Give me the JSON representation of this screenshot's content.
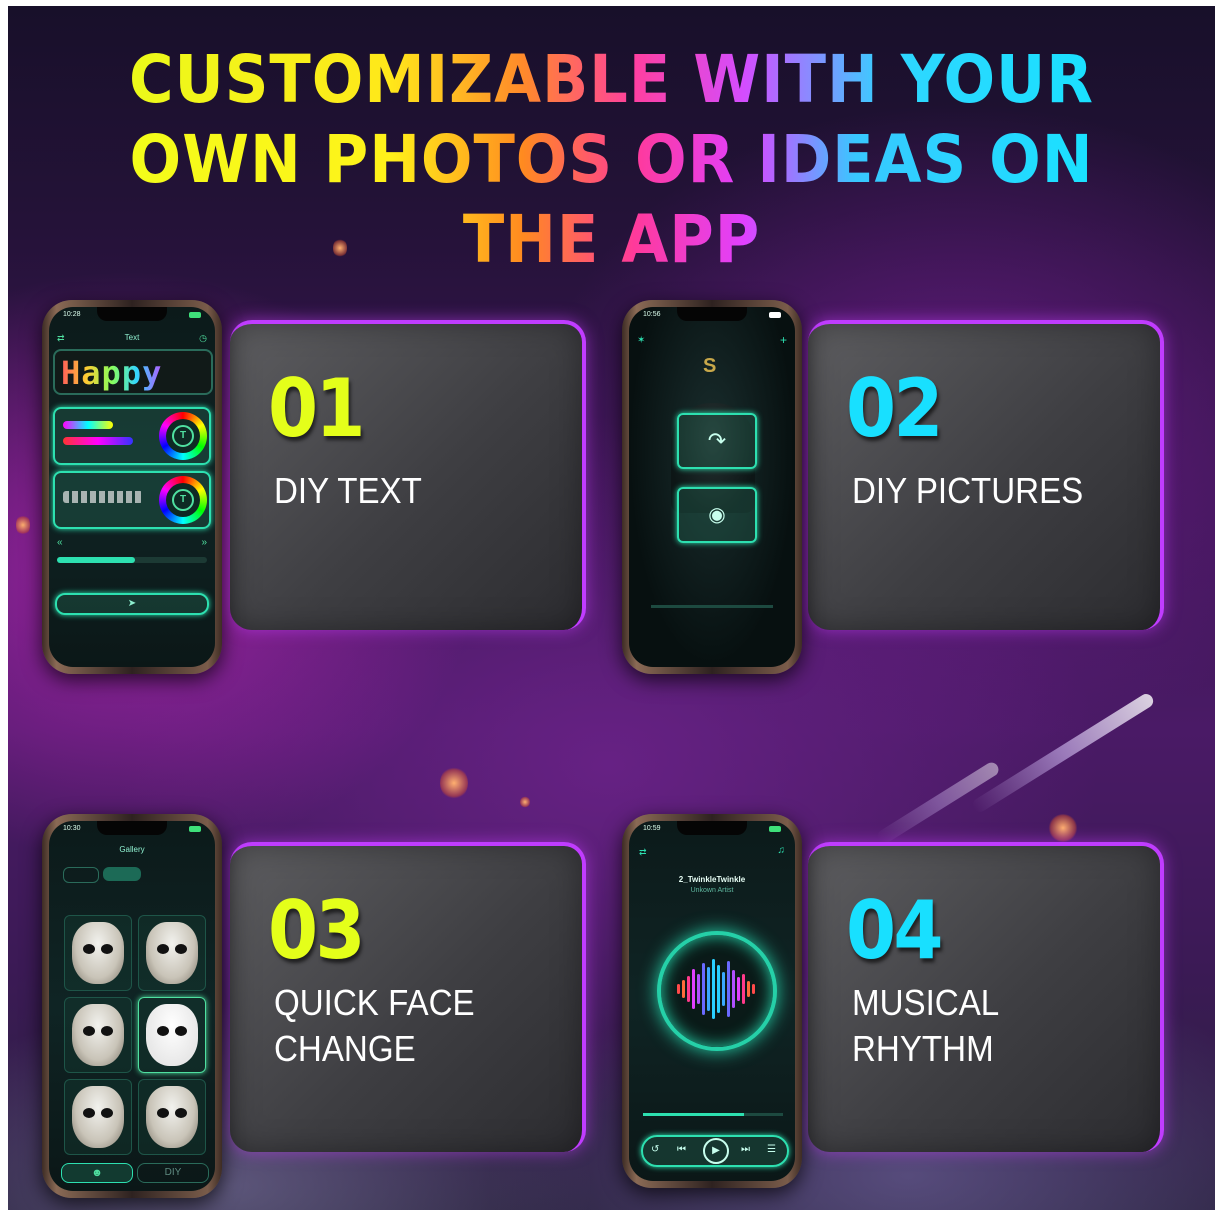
{
  "headline": {
    "line1": "CUSTOMIZABLE WITH YOUR",
    "line2": "OWN PHOTOS OR IDEAS ON THE APP"
  },
  "features": [
    {
      "number": "01",
      "label_lines": [
        "DIY TEXT"
      ],
      "color": "#e4ff1a"
    },
    {
      "number": "02",
      "label_lines": [
        "DIY PICTURES"
      ],
      "color": "#18e0ff"
    },
    {
      "number": "03",
      "label_lines": [
        "QUICK FACE",
        "CHANGE"
      ],
      "color": "#e4ff1a"
    },
    {
      "number": "04",
      "label_lines": [
        "MUSICAL",
        "RHYTHM"
      ],
      "color": "#18e0ff"
    }
  ],
  "phones": {
    "text_screen": {
      "time": "10:28",
      "title": "Text",
      "preview_text": "Happy"
    },
    "picture_screen": {
      "time": "10:56"
    },
    "gallery_screen": {
      "time": "10:30",
      "title": "Gallery",
      "diy_tab": "DIY"
    },
    "music_screen": {
      "time": "10:59",
      "track": "2_TwinkleTwinkle",
      "artist": "Unkown Artist"
    }
  },
  "colors": {
    "accent_border": "#c03cff",
    "neon": "#2de0b0"
  }
}
